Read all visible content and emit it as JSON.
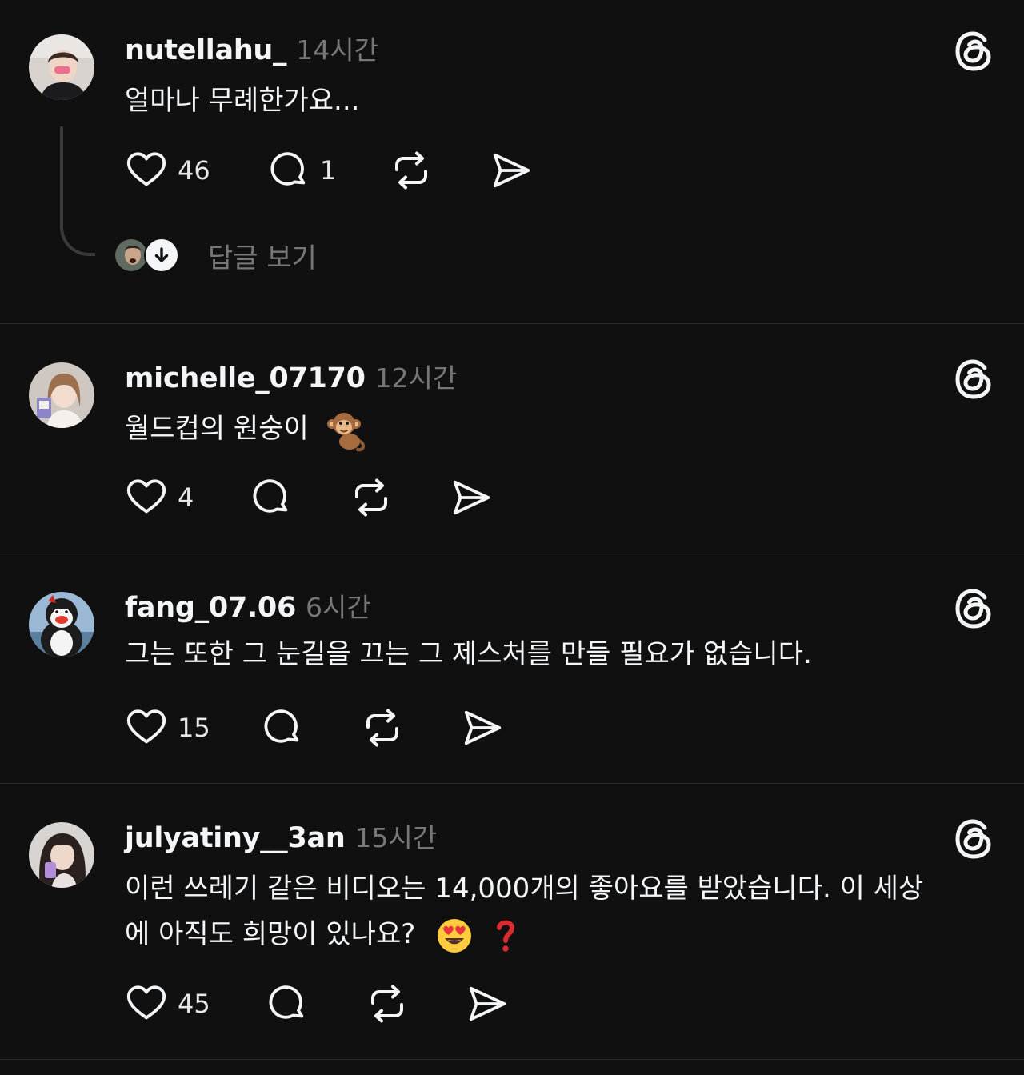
{
  "app": "Threads",
  "colors": {
    "background": "#101010",
    "text": "#f3f5f7",
    "secondary_text": "#777777",
    "divider": "#2a2a2a"
  },
  "icons": {
    "threads_logo": "threads-logo-icon",
    "like": "heart-icon",
    "reply": "comment-icon",
    "repost": "repost-icon",
    "share": "send-icon"
  },
  "posts": [
    {
      "username": "nutellahu_",
      "time": "14시간",
      "text": "얼마나 무례한가요...",
      "likes": "46",
      "replies": "1",
      "view_replies_label": "답글 보기"
    },
    {
      "username": "michelle_07170",
      "time": "12시간",
      "text": "월드컵의 원숭이",
      "emoji": "monkey-emoji",
      "likes": "4"
    },
    {
      "username": "fang_07.06",
      "time": "6시간",
      "text": "그는 또한 그 눈길을 끄는 그 제스처를 만들 필요가 없습니다.",
      "likes": "15"
    },
    {
      "username": "julyatiny__3an",
      "time": "15시간",
      "text_line1": "이런 쓰레기 같은 비디오는 14,000개의 좋아요를 받았습니다. 이 세상",
      "text_line2": "에 아직도 희망이 있나요?",
      "emojis": [
        "heart-eyes-emoji",
        "red-question-mark-emoji"
      ],
      "likes": "45"
    }
  ]
}
